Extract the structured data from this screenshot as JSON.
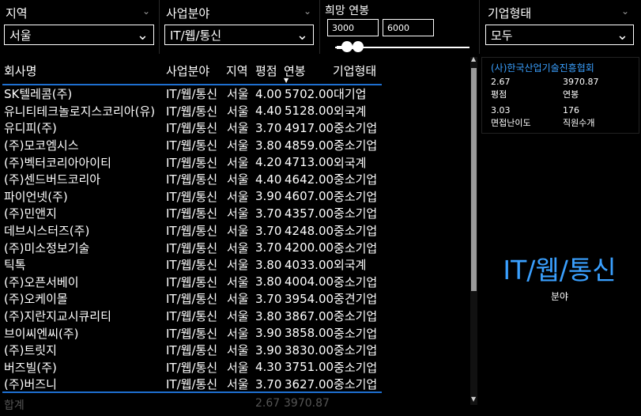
{
  "filters": {
    "region": {
      "title": "지역",
      "value": "서울"
    },
    "business": {
      "title": "사업분야",
      "value": "IT/웹/통신"
    },
    "salary": {
      "title": "희망 연봉",
      "min": "3000",
      "max": "6000"
    },
    "company_type": {
      "title": "기업형태",
      "value": "모두"
    }
  },
  "table": {
    "headers": [
      "회사명",
      "사업분야",
      "지역",
      "평점",
      "연봉",
      "기업형태"
    ],
    "rows": [
      [
        "SK텔레콤(주)",
        "IT/웹/통신",
        "서울",
        "4.00",
        "5702.00",
        "대기업"
      ],
      [
        "유니티테크놀로지스코리아(유)",
        "IT/웹/통신",
        "서울",
        "4.40",
        "5128.00",
        "외국계"
      ],
      [
        "유디피(주)",
        "IT/웹/통신",
        "서울",
        "3.70",
        "4917.00",
        "중소기업"
      ],
      [
        "(주)모코엠시스",
        "IT/웹/통신",
        "서울",
        "3.80",
        "4859.00",
        "중소기업"
      ],
      [
        "(주)벡터코리아아이티",
        "IT/웹/통신",
        "서울",
        "4.20",
        "4713.00",
        "외국계"
      ],
      [
        "(주)센드버드코리아",
        "IT/웹/통신",
        "서울",
        "4.40",
        "4642.00",
        "중소기업"
      ],
      [
        "파이언넷(주)",
        "IT/웹/통신",
        "서울",
        "3.90",
        "4607.00",
        "중소기업"
      ],
      [
        "(주)민앤지",
        "IT/웹/통신",
        "서울",
        "3.70",
        "4357.00",
        "중소기업"
      ],
      [
        "데브시스터즈(주)",
        "IT/웹/통신",
        "서울",
        "3.70",
        "4248.00",
        "중소기업"
      ],
      [
        "(주)미소정보기술",
        "IT/웹/통신",
        "서울",
        "3.70",
        "4200.00",
        "중소기업"
      ],
      [
        "틱톡",
        "IT/웹/통신",
        "서울",
        "3.80",
        "4033.00",
        "외국계"
      ],
      [
        "(주)오픈서베이",
        "IT/웹/통신",
        "서울",
        "3.80",
        "4004.00",
        "중소기업"
      ],
      [
        "(주)오케이몰",
        "IT/웹/통신",
        "서울",
        "3.70",
        "3954.00",
        "중견기업"
      ],
      [
        "(주)지란지교시큐리티",
        "IT/웹/통신",
        "서울",
        "3.80",
        "3867.00",
        "중소기업"
      ],
      [
        "브이씨엔씨(주)",
        "IT/웹/통신",
        "서울",
        "3.90",
        "3858.00",
        "중소기업"
      ],
      [
        "(주)트릿지",
        "IT/웹/통신",
        "서울",
        "3.90",
        "3830.00",
        "중소기업"
      ],
      [
        "버즈빌(주)",
        "IT/웹/통신",
        "서울",
        "4.30",
        "3751.00",
        "중소기업"
      ],
      [
        "(주)버즈니",
        "IT/웹/통신",
        "서울",
        "3.70",
        "3627.00",
        "중소기업"
      ]
    ],
    "total": {
      "label": "합계",
      "rating": "2.67",
      "salary": "3970.87"
    }
  },
  "card": {
    "title": "(사)한국산업기술진흥협회",
    "rating": "2.67",
    "rating_label": "평점",
    "salary": "3970.87",
    "salary_label": "연봉",
    "interview": "3.03",
    "interview_label": "면접난이도",
    "employees": "176",
    "employees_label": "직원수개"
  },
  "big_card": {
    "value": "IT/웹/통신",
    "label": "분야"
  },
  "colors": {
    "accent": "#3aa0ff",
    "background": "#000000",
    "divider": "#1e6fd0"
  }
}
